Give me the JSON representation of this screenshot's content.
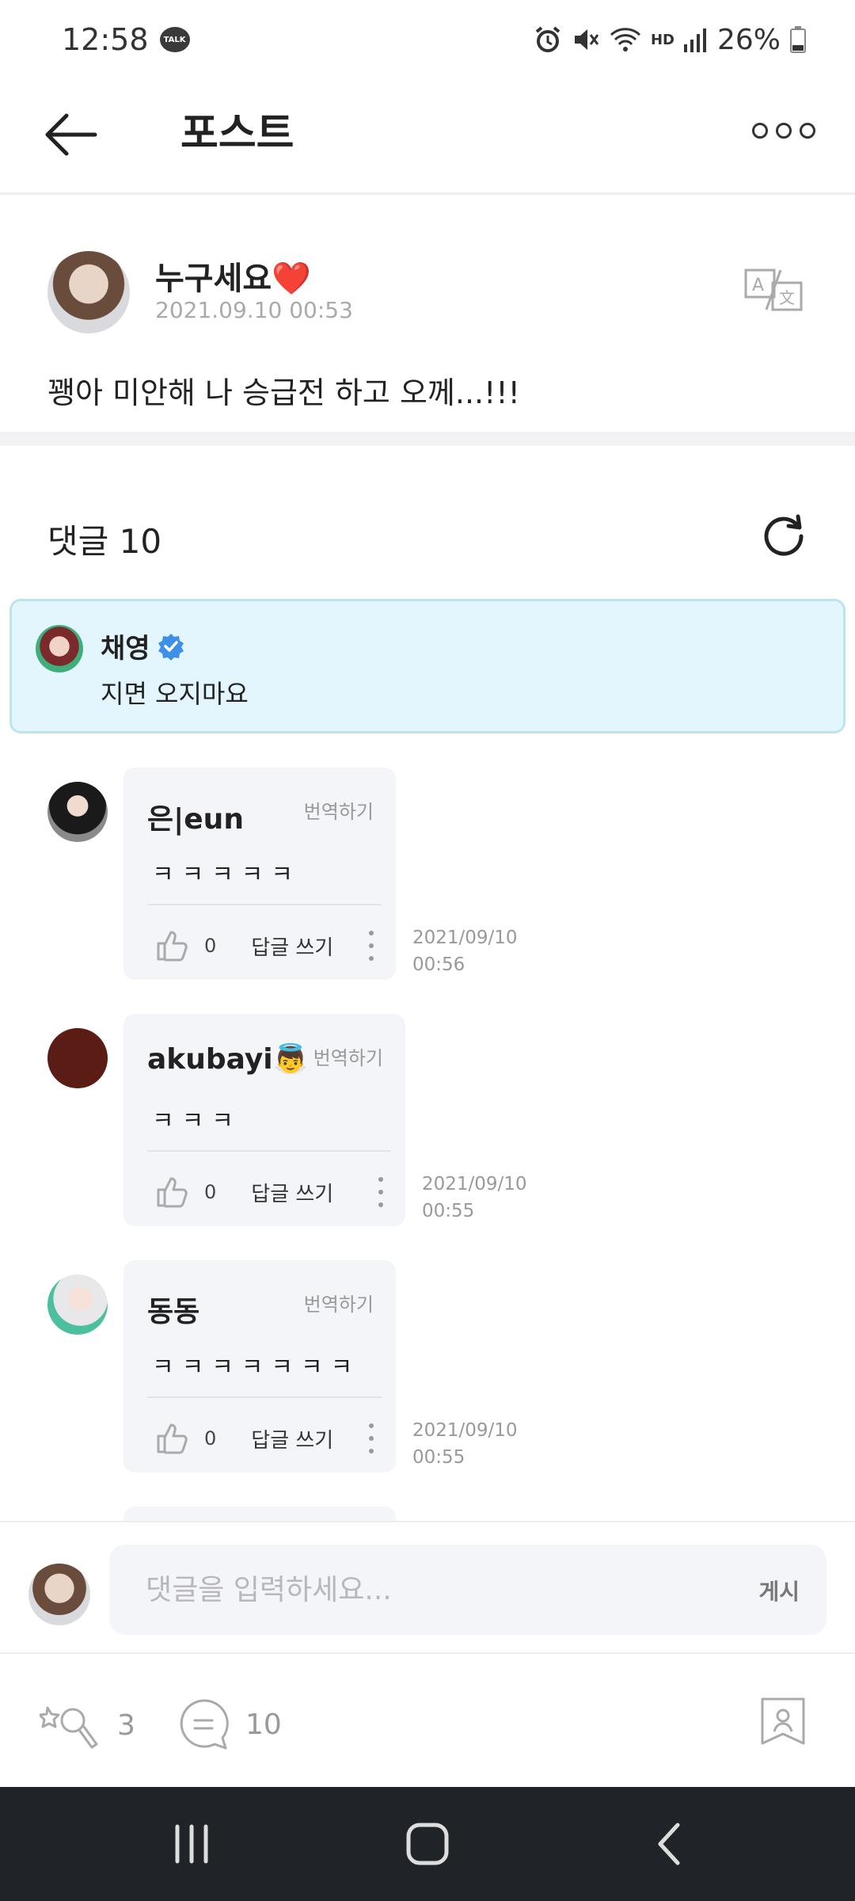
{
  "status_bar": {
    "time": "12:58",
    "talk_badge": "TALK",
    "hd_label": "HD",
    "battery": "26%"
  },
  "header": {
    "title": "포스트"
  },
  "post": {
    "author": "누구세요❤️",
    "date": "2021.09.10 00:53",
    "text": "꽹아 미안해 나 승급전 하고 오께...!!!"
  },
  "comments": {
    "title": "댓글 10",
    "pinned": {
      "name": "채영",
      "text": "지면 오지마요"
    },
    "translate_label": "번역하기",
    "reply_label": "답글 쓰기",
    "items": [
      {
        "name": "은|eun",
        "text": "ㅋㅋㅋㅋㅋ",
        "likes": "0",
        "date": "2021/09/10",
        "time": "00:56"
      },
      {
        "name": "akubayi👼",
        "text": "ㅋㅋㅋ",
        "likes": "0",
        "date": "2021/09/10",
        "time": "00:55"
      },
      {
        "name": "동동",
        "text": "ㅋㅋㅋㅋㅋㅋㅋ",
        "likes": "0",
        "date": "2021/09/10",
        "time": "00:55"
      }
    ]
  },
  "input_bar": {
    "placeholder": "댓글을 입력하세요...",
    "post_label": "게시"
  },
  "actions": {
    "cheer_count": "3",
    "comment_count": "10"
  }
}
